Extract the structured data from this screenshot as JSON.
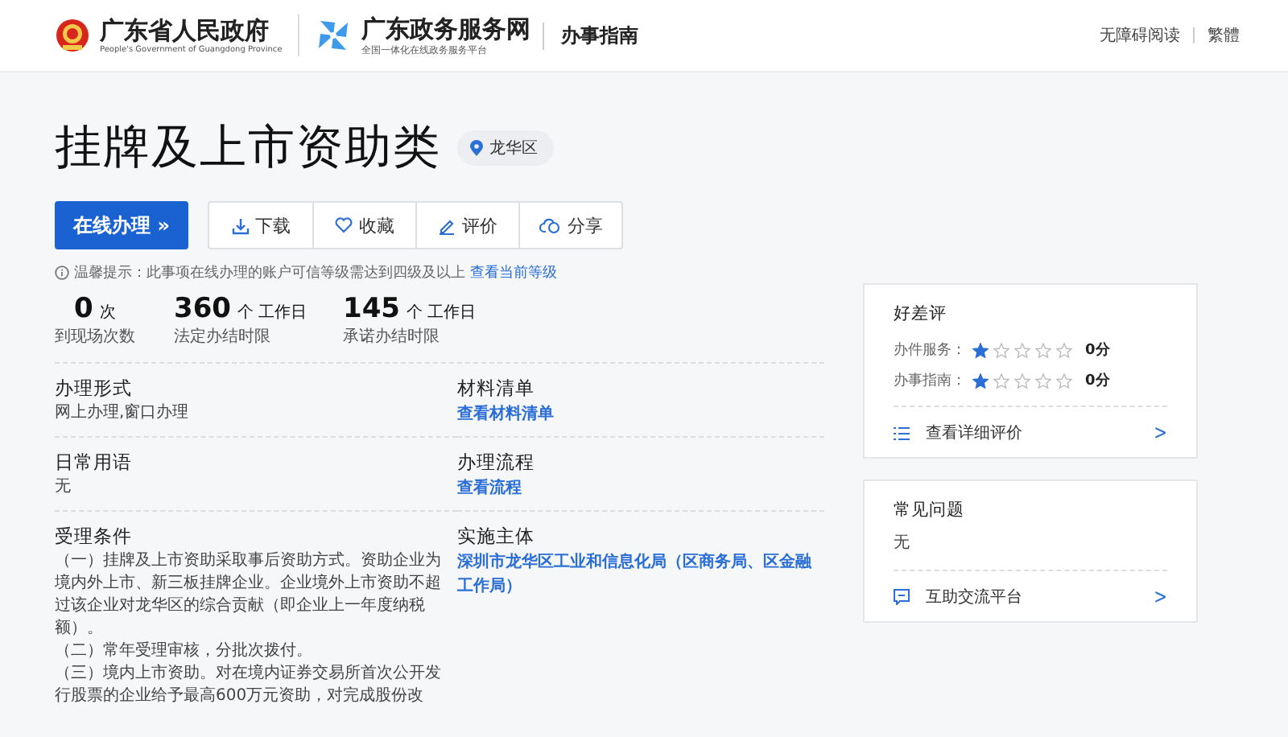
{
  "header": {
    "gov_name": "广东省人民政府",
    "gov_name_en": "People's Government of Guangdong Province",
    "portal_name": "广东政务服务网",
    "portal_sub": "全国一体化在线政务服务平台",
    "section": "办事指南",
    "links": [
      "无障碍阅读",
      "繁體"
    ]
  },
  "item": {
    "title": "挂牌及上市资助类",
    "region": "龙华区"
  },
  "actions": {
    "primary": "在线办理",
    "primary_glyph": "»",
    "buttons": [
      {
        "kind": "download",
        "label": "下载"
      },
      {
        "kind": "favorite",
        "label": "收藏"
      },
      {
        "kind": "review",
        "label": "评价"
      },
      {
        "kind": "share",
        "label": "分享"
      }
    ]
  },
  "notice": {
    "text": "温馨提示：此事项在线办理的账户可信等级需达到四级及以上",
    "link": "查看当前等级"
  },
  "stats": [
    {
      "value": "0",
      "unit": "次",
      "label": "到现场次数"
    },
    {
      "value": "360",
      "unit": "个 工作日",
      "label": "法定办结时限"
    },
    {
      "value": "145",
      "unit": "个 工作日",
      "label": "承诺办结时限"
    }
  ],
  "details": [
    {
      "label": "办理形式",
      "kind": "text",
      "value": [
        "网上办理,窗口办理"
      ]
    },
    {
      "label": "材料清单",
      "kind": "link",
      "value": [
        "查看材料清单"
      ]
    },
    {
      "label": "日常用语",
      "kind": "text",
      "value": [
        "无"
      ]
    },
    {
      "label": "办理流程",
      "kind": "link",
      "value": [
        "查看流程"
      ]
    },
    {
      "label": "受理条件",
      "kind": "text",
      "value": [
        "（一）挂牌及上市资助采取事后资助方式。资助企业为境内外上市、新三板挂牌企业。企业境外上市资助不超过该企业对龙华区的综合贡献（即企业上一年度纳税额）。",
        "（二）常年受理审核，分批次拨付。",
        "（三）境内上市资助。对在境内证券交易所首次公开发行股票的企业给予最高600万元资助，对完成股份改"
      ]
    },
    {
      "label": "实施主体",
      "kind": "link",
      "value": [
        "深圳市龙华区工业和信息化局（区商务局、区金融工作局）"
      ]
    }
  ],
  "rating_card": {
    "title": "好差评",
    "ratings": [
      {
        "label": "办件服务：",
        "stars": 1,
        "score": "0分"
      },
      {
        "label": "办事指南：",
        "stars": 1,
        "score": "0分"
      }
    ],
    "link": "查看详细评价",
    "link_glyph": ">"
  },
  "faq_card": {
    "title": "常见问题",
    "value": "无",
    "link": "互助交流平台",
    "link_glyph": ">"
  }
}
